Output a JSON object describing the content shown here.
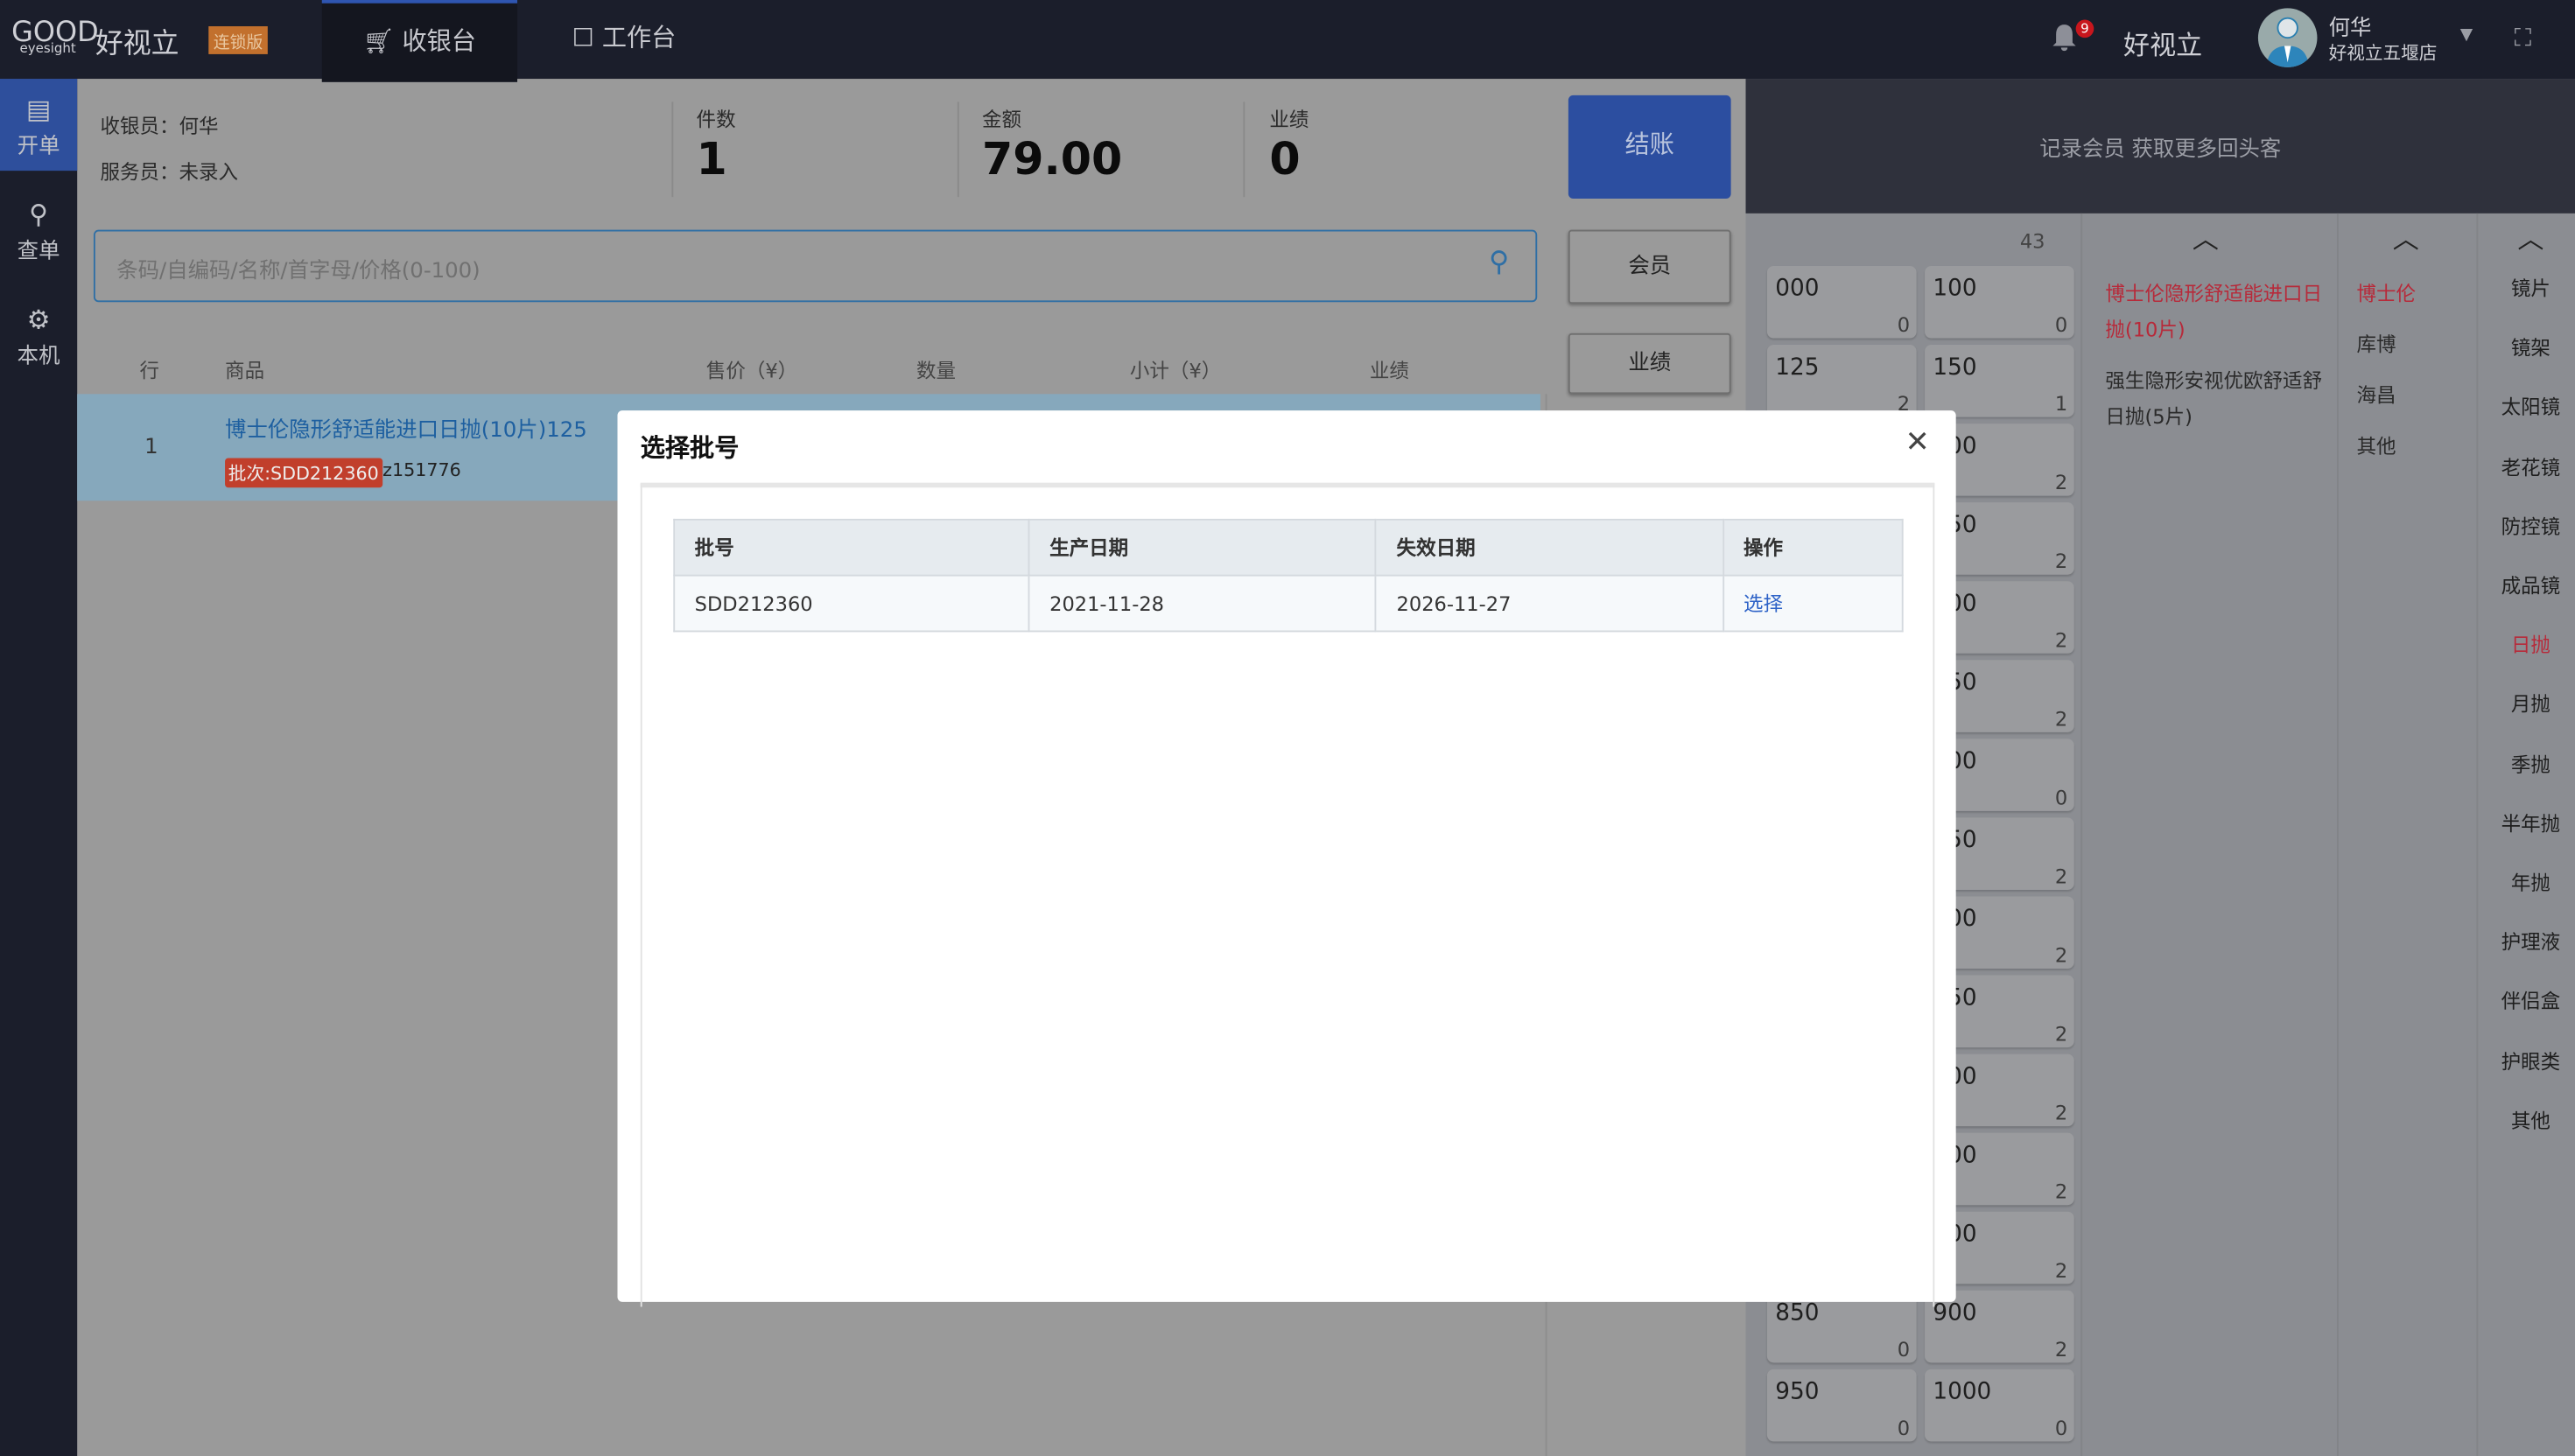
{
  "header": {
    "logo_text": "GOOD",
    "logo_sub": "eyesight",
    "brand": "好视立",
    "edition_badge": "连锁版",
    "tabs": [
      {
        "label": "收银台",
        "icon": "cart-icon",
        "active": true
      },
      {
        "label": "工作台",
        "icon": "monitor-icon",
        "active": false
      }
    ],
    "notification_count": "9",
    "company": "好视立",
    "user_name": "何华",
    "store": "好视立五堰店"
  },
  "sidebar": {
    "items": [
      {
        "label": "开单",
        "icon": "document-icon",
        "active": true
      },
      {
        "label": "查单",
        "icon": "search-icon"
      },
      {
        "label": "本机",
        "icon": "gear-icon"
      }
    ]
  },
  "order": {
    "cashier": "收银员：何华",
    "server": "服务员：未录入",
    "stats": [
      {
        "label": "件数",
        "value": "1"
      },
      {
        "label": "金额",
        "value": "79.00"
      },
      {
        "label": "业绩",
        "value": "0"
      }
    ],
    "checkout_label": "结账",
    "member_label": "会员",
    "performance_label": "业绩",
    "search_placeholder": "条码/自编码/名称/首字母/价格(0-100)",
    "columns": [
      "行",
      "商品",
      "售价（¥）",
      "数量",
      "小计（¥）",
      "业绩"
    ],
    "rows": [
      {
        "index": "1",
        "name": "博士伦隐形舒适能进口日抛(10片)125",
        "batch": "批次:SDD212360",
        "code": "z151776"
      }
    ]
  },
  "right_panel": {
    "banner": "记录会员 获取更多回头客",
    "total": "43",
    "powers": [
      [
        {
          "v": "000",
          "c": "0"
        },
        {
          "v": "100",
          "c": "0"
        }
      ],
      [
        {
          "v": "125",
          "c": "2"
        },
        {
          "v": "150",
          "c": "1"
        }
      ],
      [
        {
          "v": "",
          "c": ""
        },
        {
          "v": "200",
          "c": "2"
        }
      ],
      [
        {
          "v": "",
          "c": ""
        },
        {
          "v": "250",
          "c": "2"
        }
      ],
      [
        {
          "v": "",
          "c": ""
        },
        {
          "v": "300",
          "c": "2"
        }
      ],
      [
        {
          "v": "",
          "c": ""
        },
        {
          "v": "350",
          "c": "2"
        }
      ],
      [
        {
          "v": "",
          "c": ""
        },
        {
          "v": "400",
          "c": "0"
        }
      ],
      [
        {
          "v": "",
          "c": ""
        },
        {
          "v": "450",
          "c": "2"
        }
      ],
      [
        {
          "v": "",
          "c": ""
        },
        {
          "v": "500",
          "c": "2"
        }
      ],
      [
        {
          "v": "",
          "c": ""
        },
        {
          "v": "550",
          "c": "2"
        }
      ],
      [
        {
          "v": "",
          "c": ""
        },
        {
          "v": "600",
          "c": "2"
        }
      ],
      [
        {
          "v": "",
          "c": ""
        },
        {
          "v": "700",
          "c": "2"
        }
      ],
      [
        {
          "v": "",
          "c": ""
        },
        {
          "v": "800",
          "c": "2"
        }
      ],
      [
        {
          "v": "850",
          "c": "0"
        },
        {
          "v": "900",
          "c": "2"
        }
      ],
      [
        {
          "v": "950",
          "c": "0"
        },
        {
          "v": "1000",
          "c": "0"
        }
      ]
    ],
    "products": [
      {
        "label": "博士伦隐形舒适能进口日抛(10片)",
        "active": true
      },
      {
        "label": "强生隐形安视优欧舒适舒日抛(5片)",
        "active": false
      }
    ],
    "brands": [
      {
        "label": "博士伦",
        "active": true
      },
      {
        "label": "库博"
      },
      {
        "label": "海昌"
      },
      {
        "label": "其他"
      }
    ],
    "categories": [
      {
        "label": "镜片"
      },
      {
        "label": "镜架"
      },
      {
        "label": "太阳镜"
      },
      {
        "label": "老花镜"
      },
      {
        "label": "防控镜"
      },
      {
        "label": "成品镜"
      },
      {
        "label": "日抛",
        "active": true
      },
      {
        "label": "月抛"
      },
      {
        "label": "季抛"
      },
      {
        "label": "半年抛"
      },
      {
        "label": "年抛"
      },
      {
        "label": "护理液"
      },
      {
        "label": "伴侣盒"
      },
      {
        "label": "护眼类"
      },
      {
        "label": "其他"
      }
    ],
    "active_color": "#b72a3a"
  },
  "modal": {
    "title": "选择批号",
    "close": "✕",
    "columns": [
      "批号",
      "生产日期",
      "失效日期",
      "操作"
    ],
    "rows": [
      {
        "batch": "SDD212360",
        "produced": "2021-11-28",
        "expires": "2026-11-27",
        "action": "选择"
      }
    ]
  }
}
